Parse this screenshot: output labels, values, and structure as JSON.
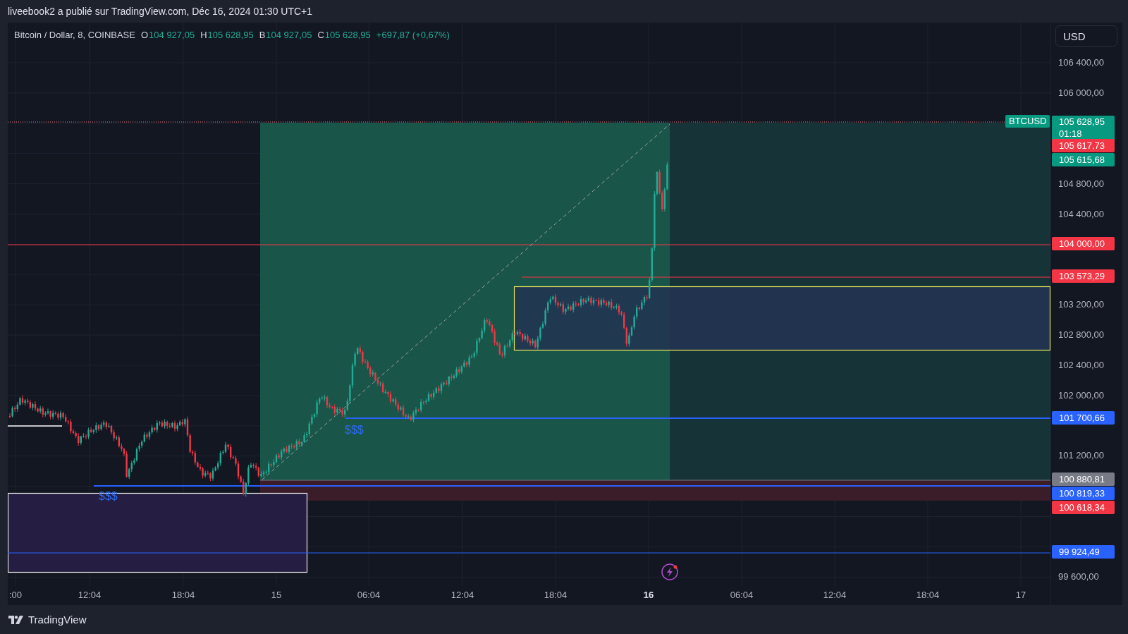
{
  "header": {
    "text": "liveebook2 a publié sur TradingView.com, Déc 16, 2024 01:30 UTC+1"
  },
  "legend": {
    "symbol": "Bitcoin / Dollar, 8, COINBASE",
    "fields": [
      {
        "label": "O",
        "value": "104 927,05"
      },
      {
        "label": "H",
        "value": "105 628,95"
      },
      {
        "label": "B",
        "value": "104 927,05"
      },
      {
        "label": "C",
        "value": "105 628,95"
      }
    ],
    "change": "+697,87 (+0,67%)"
  },
  "currency_button": "USD",
  "price_axis": {
    "ticks": [
      "106 400,00",
      "106 000,00",
      "104 800,00",
      "104 400,00",
      "103 200,00",
      "102 800,00",
      "102 400,00",
      "102 000,00",
      "101 200,00",
      "99 600,00"
    ]
  },
  "symbol_tag": {
    "text": "BTCUSD",
    "color": "#089981"
  },
  "price_tags": [
    {
      "text": "105 628,95",
      "subtext": "01:18",
      "color": "#089981"
    },
    {
      "text": "105 617,73",
      "color": "#f23645"
    },
    {
      "text": "105 615,68",
      "color": "#089981"
    },
    {
      "text": "104 000,00",
      "color": "#f23645"
    },
    {
      "text": "103 573,29",
      "color": "#f23645"
    },
    {
      "text": "101 700,66",
      "color": "#2962ff"
    },
    {
      "text": "100 880,81",
      "color": "#787b86"
    },
    {
      "text": "100 819,33",
      "color": "#2962ff"
    },
    {
      "text": "100 618,34",
      "color": "#f23645"
    },
    {
      "text": "99 924,49",
      "color": "#2962ff"
    }
  ],
  "annotations": [
    {
      "text": "$$$"
    },
    {
      "text": "$$$"
    }
  ],
  "time_axis": {
    "labels": [
      {
        "text": ":00",
        "bold": false
      },
      {
        "text": "12:04",
        "bold": false
      },
      {
        "text": "18:04",
        "bold": false
      },
      {
        "text": "15",
        "bold": false
      },
      {
        "text": "06:04",
        "bold": false
      },
      {
        "text": "12:04",
        "bold": false
      },
      {
        "text": "18:04",
        "bold": false
      },
      {
        "text": "16",
        "bold": true
      },
      {
        "text": "06:04",
        "bold": false
      },
      {
        "text": "12:04",
        "bold": false
      },
      {
        "text": "18:04",
        "bold": false
      },
      {
        "text": "17",
        "bold": false
      }
    ]
  },
  "footer": {
    "brand": "TradingView"
  }
}
